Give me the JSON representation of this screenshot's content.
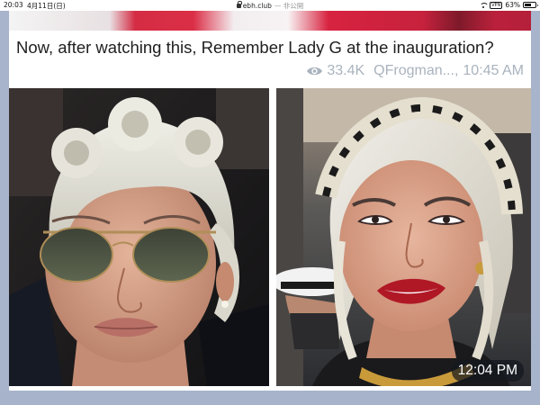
{
  "status_bar": {
    "time": "20:03",
    "date": "4月11日(日)",
    "url": "ebh.club",
    "url_sub": "— 非公開",
    "battery_percent": "63%",
    "battery_level": 0.63,
    "vpn": "VPN",
    "icons": [
      "wifi-icon",
      "vpn-badge",
      "battery-icon",
      "lock-icon"
    ]
  },
  "message": {
    "caption": "Now, after watching this, Remember Lady G at the inauguration?",
    "views": "33.4K",
    "author": "QFrogman...,",
    "posted_time": "10:45 AM",
    "photo_time": "12:04 PM",
    "icons": [
      "eye-icon"
    ]
  },
  "colors": {
    "text": "#1f1f1f",
    "meta": "#a9b3bd",
    "background": "#a8b4cc",
    "card": "#ffffff"
  }
}
